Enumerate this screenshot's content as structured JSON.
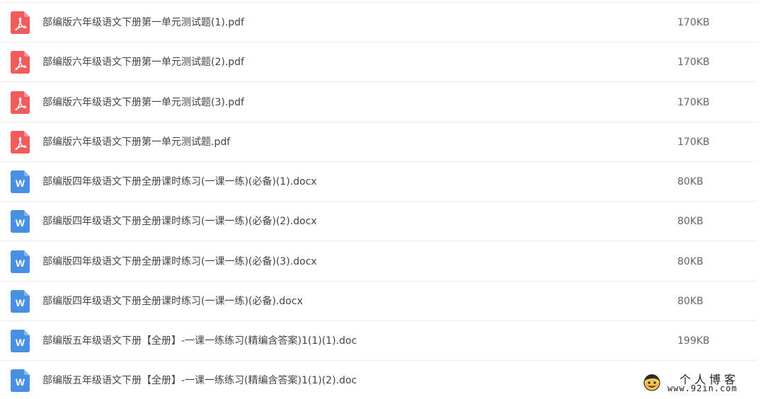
{
  "files": [
    {
      "name": "部编版六年级语文下册第一单元测试题(1).pdf",
      "size": "170KB",
      "icon": "pdf-icon"
    },
    {
      "name": "部编版六年级语文下册第一单元测试题(2).pdf",
      "size": "170KB",
      "icon": "pdf-icon"
    },
    {
      "name": "部编版六年级语文下册第一单元测试题(3).pdf",
      "size": "170KB",
      "icon": "pdf-icon"
    },
    {
      "name": "部编版六年级语文下册第一单元测试题.pdf",
      "size": "170KB",
      "icon": "pdf-icon"
    },
    {
      "name": "部编版四年级语文下册全册课时练习(一课一练)(必备)(1).docx",
      "size": "80KB",
      "icon": "word-icon"
    },
    {
      "name": "部编版四年级语文下册全册课时练习(一课一练)(必备)(2).docx",
      "size": "80KB",
      "icon": "word-icon"
    },
    {
      "name": "部编版四年级语文下册全册课时练习(一课一练)(必备)(3).docx",
      "size": "80KB",
      "icon": "word-icon"
    },
    {
      "name": "部编版四年级语文下册全册课时练习(一课一练)(必备).docx",
      "size": "80KB",
      "icon": "word-icon"
    },
    {
      "name": "部编版五年级语文下册【全册】-一课一练练习(精编含答案)1(1)(1).doc",
      "size": "199KB",
      "icon": "word-icon"
    },
    {
      "name": "部编版五年级语文下册【全册】-一课一练练习(精编含答案)1(1)(2).doc",
      "size": "",
      "icon": "word-icon"
    }
  ],
  "icons": {
    "pdf_color": "#f15b5b",
    "word_color": "#4a90e2",
    "word_letter": "W"
  },
  "watermark": {
    "title": "个人博客",
    "url": "www.92in.com"
  }
}
